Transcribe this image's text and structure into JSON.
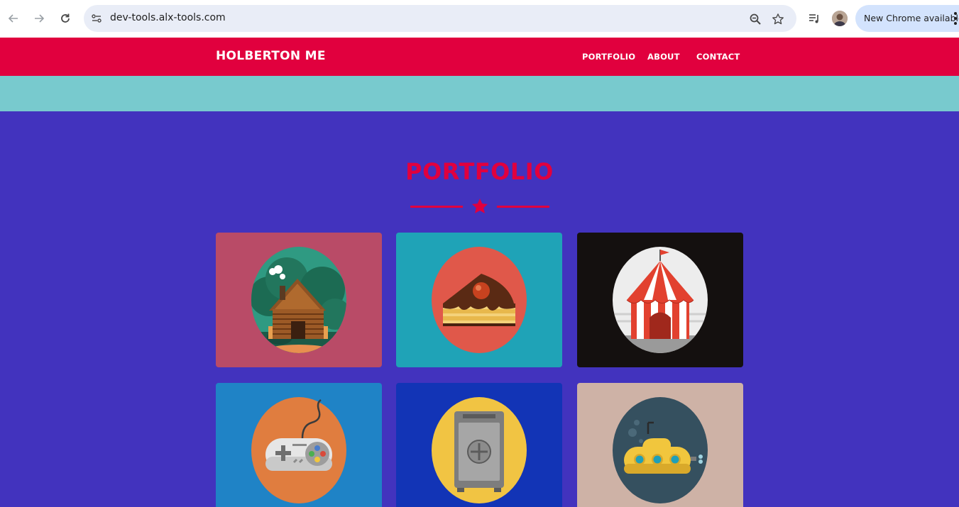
{
  "browser": {
    "url": "dev-tools.alx-tools.com",
    "update_label": "New Chrome available",
    "icons": [
      "back-arrow-icon",
      "forward-arrow-icon",
      "reload-icon",
      "site-info-icon",
      "zoom-icon",
      "bookmark-star-icon",
      "media-playlist-icon",
      "profile-avatar",
      "kebab-menu-icon"
    ]
  },
  "header": {
    "brand": "HOLBERTON ME",
    "nav": [
      "PORTFOLIO",
      "ABOUT",
      "CONTACT"
    ]
  },
  "portfolio": {
    "title": "PORTFOLIO",
    "divider_icon": "star-icon",
    "items": [
      {
        "name": "cabin",
        "icon": "log-cabin-icon",
        "bg": "#b94b67",
        "circle": "#2f9a82"
      },
      {
        "name": "cake",
        "icon": "cake-slice-icon",
        "bg": "#1fa3b7",
        "circle": "#e0584a"
      },
      {
        "name": "circus",
        "icon": "circus-tent-icon",
        "bg": "#14100f",
        "circle": "#ededed"
      },
      {
        "name": "game",
        "icon": "game-controller-icon",
        "bg": "#1f83c6",
        "circle": "#e07d3f"
      },
      {
        "name": "safe",
        "icon": "safe-icon",
        "bg": "#1234b6",
        "circle": "#f1c443"
      },
      {
        "name": "submarine",
        "icon": "submarine-icon",
        "bg": "#ceb2a6",
        "circle": "#35505f"
      }
    ]
  },
  "colors": {
    "header_bg": "#e1003e",
    "teal_band": "#78cace",
    "page_bg": "#4233be",
    "accent": "#e1003e"
  }
}
